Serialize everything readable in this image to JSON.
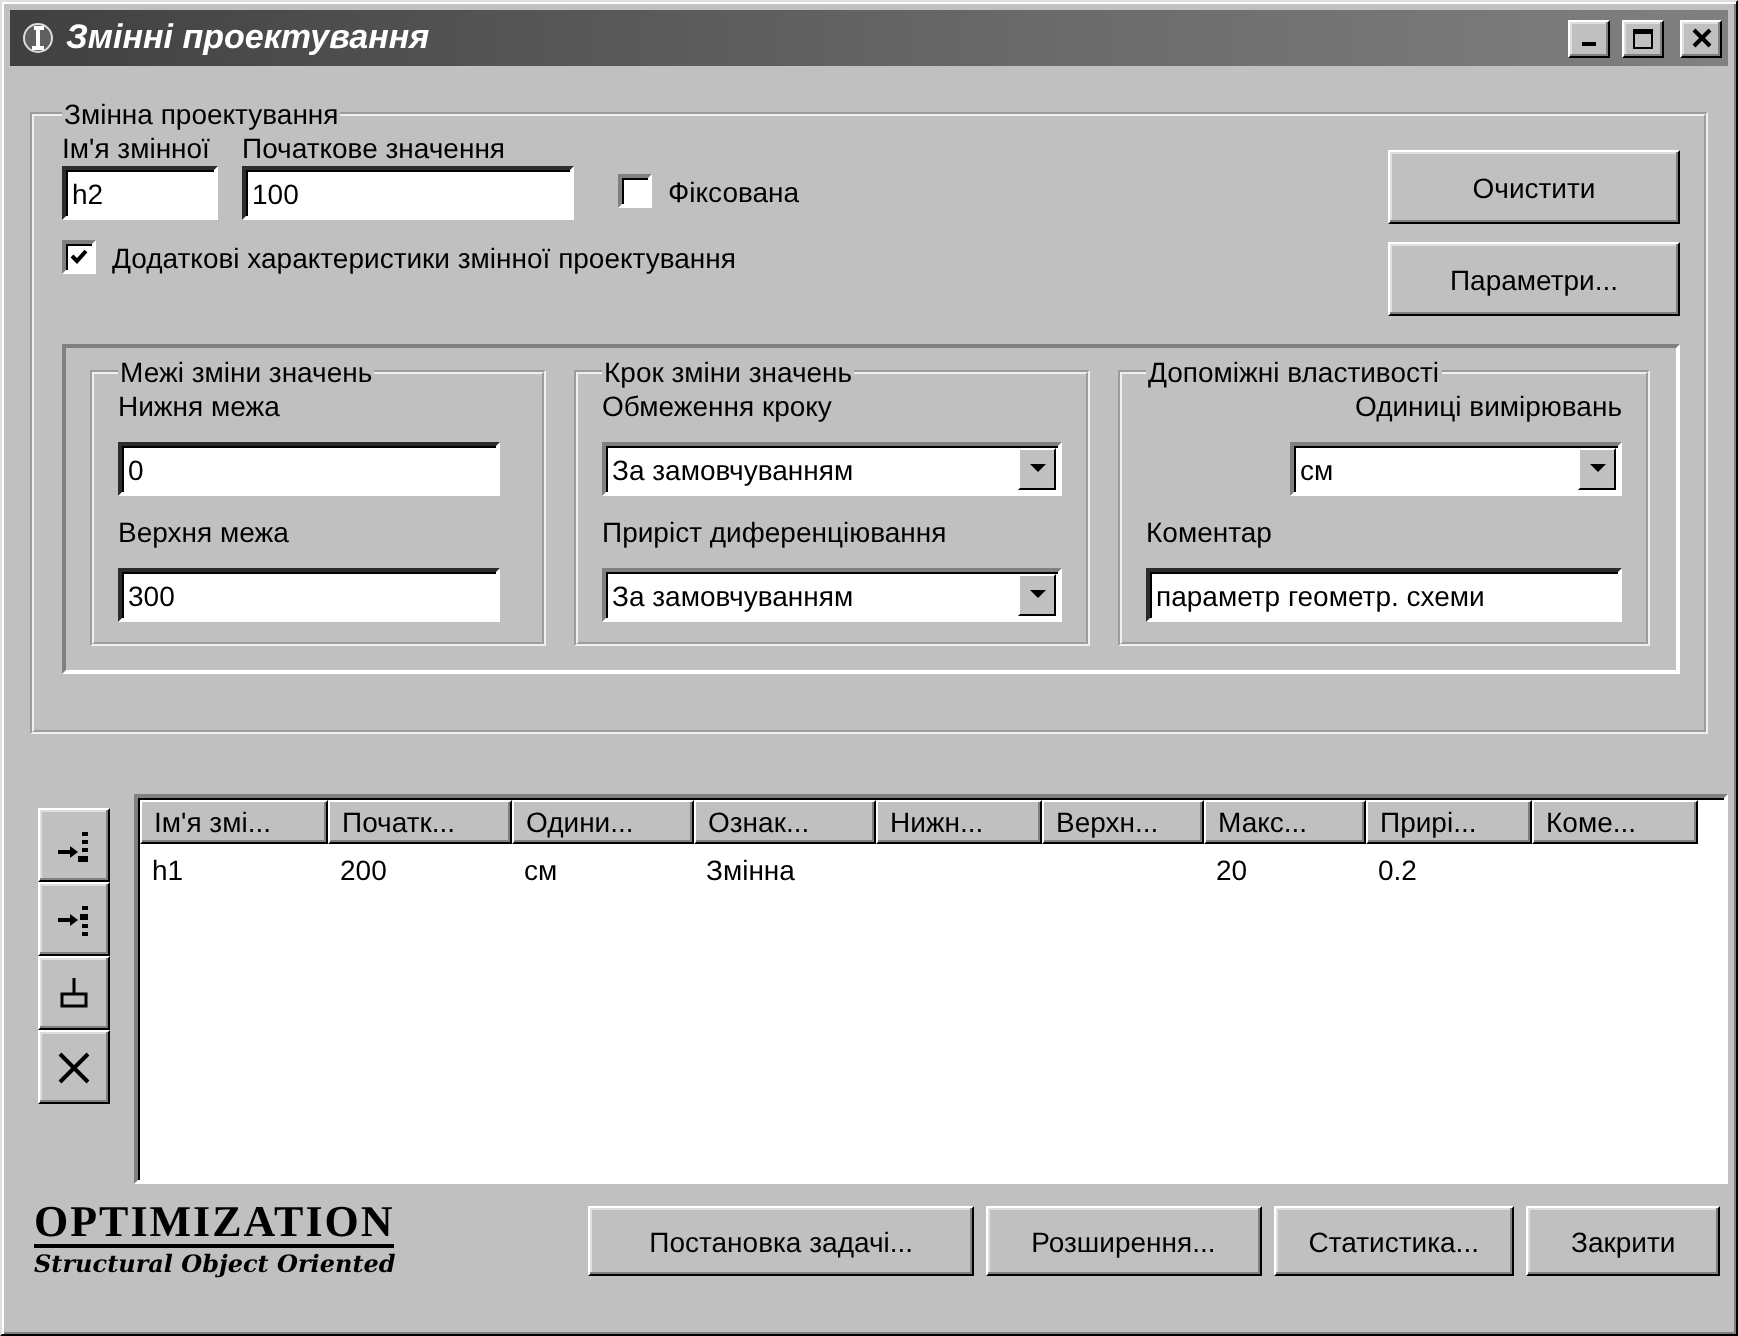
{
  "window": {
    "title": "Змінні проектування"
  },
  "design_variable": {
    "legend": "Змінна проектування",
    "name_label": "Ім'я змінної",
    "name_value": "h2",
    "initial_label": "Початкове значення",
    "initial_value": "100",
    "fixed": {
      "label": "Фіксована",
      "checked": false
    },
    "extra": {
      "label": "Додаткові характеристики змінної проектування",
      "checked": true
    },
    "buttons": [
      "Очистити",
      "Параметри..."
    ],
    "limits": {
      "legend": "Межі зміни значень",
      "lower_label": "Нижня межа",
      "lower_value": "0",
      "upper_label": "Верхня межа",
      "upper_value": "300"
    },
    "step": {
      "legend": "Крок зміни значень",
      "limit_label": "Обмеження кроку",
      "limit_value": "За замовчуванням",
      "increment_label": "Приріст диференціювання",
      "increment_value": "За замовчуванням"
    },
    "aux": {
      "legend": "Допоміжні властивості",
      "units_label": "Одиниці вимірювань",
      "units_value": "см",
      "comment_label": "Коментар",
      "comment_value": "параметр геометр. схеми"
    }
  },
  "table": {
    "columns": [
      "Ім'я змі...",
      "Початк...",
      "Одини...",
      "Ознак...",
      "Нижн...",
      "Верхн...",
      "Макс...",
      "Прирі...",
      "Коме..."
    ],
    "rows": [
      {
        "cells": [
          "h1",
          "200",
          "см",
          "Змінна",
          null,
          null,
          "20",
          "0.2",
          null
        ],
        "selected": false
      }
    ]
  },
  "logo": {
    "title": "OPTIMIZATION",
    "subtitle": "Structural Object Oriented"
  },
  "buttons": [
    "Постановка задачі...",
    "Розширення...",
    "Статистика...",
    "Закрити"
  ]
}
